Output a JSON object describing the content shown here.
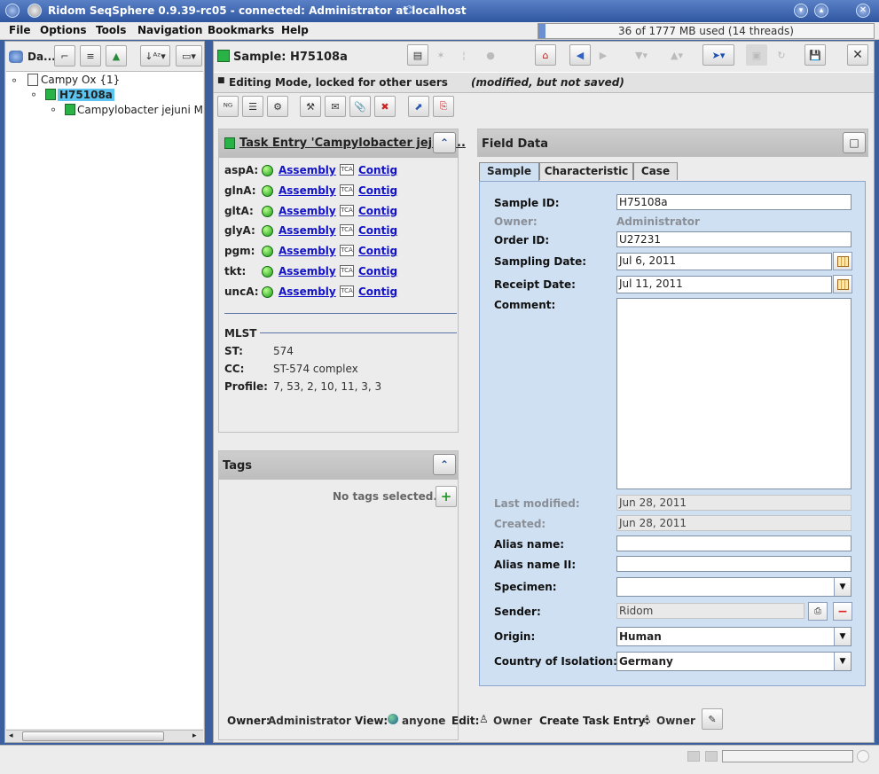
{
  "window": {
    "title": "Ridom SeqSphere 0.9.39-rc05 - connected: Administrator at localhost"
  },
  "menu": [
    "File",
    "Options",
    "Tools",
    "Navigation",
    "Bookmarks",
    "Help"
  ],
  "memory": {
    "text": "36 of 1777 MB used (14 threads)",
    "used_fraction": 0.02
  },
  "left": {
    "tab_label": "Da...",
    "tree": {
      "root": "Campy Ox {1}",
      "sample": "H75108a",
      "task": "Campylobacter jejuni MLST"
    }
  },
  "main": {
    "sample_title": "Sample: H75108a",
    "editing": {
      "mode": "Editing Mode, locked for other users",
      "state": "(modified, but not saved)"
    },
    "task_entry": {
      "title": "Task Entry 'Campylobacter jejuni...",
      "genes": [
        {
          "name": "aspA:",
          "assembly": "Assembly",
          "contig": "Contig"
        },
        {
          "name": "glnA:",
          "assembly": "Assembly",
          "contig": "Contig"
        },
        {
          "name": "gltA:",
          "assembly": "Assembly",
          "contig": "Contig"
        },
        {
          "name": "glyA:",
          "assembly": "Assembly",
          "contig": "Contig"
        },
        {
          "name": "pgm:",
          "assembly": "Assembly",
          "contig": "Contig"
        },
        {
          "name": "tkt:",
          "assembly": "Assembly",
          "contig": "Contig"
        },
        {
          "name": "uncA:",
          "assembly": "Assembly",
          "contig": "Contig"
        }
      ],
      "mlst": {
        "heading": "MLST",
        "st_label": "ST:",
        "st": "574",
        "cc_label": "CC:",
        "cc": "ST-574 complex",
        "profile_label": "Profile:",
        "profile": "7, 53, 2, 10, 11, 3, 3"
      }
    },
    "tags": {
      "title": "Tags",
      "empty": "No tags selected."
    },
    "field_data": {
      "title": "Field Data",
      "tabs": [
        "Sample",
        "Characteristic",
        "Case"
      ],
      "active_tab": "Sample",
      "sample_id": {
        "label": "Sample ID:",
        "value": "H75108a"
      },
      "owner": {
        "label": "Owner:",
        "value": "Administrator"
      },
      "order_id": {
        "label": "Order ID:",
        "value": "U27231"
      },
      "sampling_date": {
        "label": "Sampling Date:",
        "value": "Jul 6, 2011"
      },
      "receipt_date": {
        "label": "Receipt Date:",
        "value": "Jul 11, 2011"
      },
      "comment": {
        "label": "Comment:",
        "value": ""
      },
      "last_modified": {
        "label": "Last modified:",
        "value": "Jun 28, 2011"
      },
      "created": {
        "label": "Created:",
        "value": "Jun 28, 2011"
      },
      "alias": {
        "label": "Alias name:",
        "value": ""
      },
      "alias2": {
        "label": "Alias name II:",
        "value": ""
      },
      "specimen": {
        "label": "Specimen:",
        "value": ""
      },
      "sender": {
        "label": "Sender:",
        "value": "Ridom"
      },
      "origin": {
        "label": "Origin:",
        "value": "Human"
      },
      "country": {
        "label": "Country of Isolation:",
        "value": "Germany"
      }
    },
    "footer": {
      "owner_label": "Owner:",
      "owner": "Administrator",
      "view_label": "View:",
      "view": "anyone",
      "edit_label": "Edit:",
      "edit": "Owner",
      "create_label": "Create Task Entry:",
      "create": "Owner"
    }
  }
}
